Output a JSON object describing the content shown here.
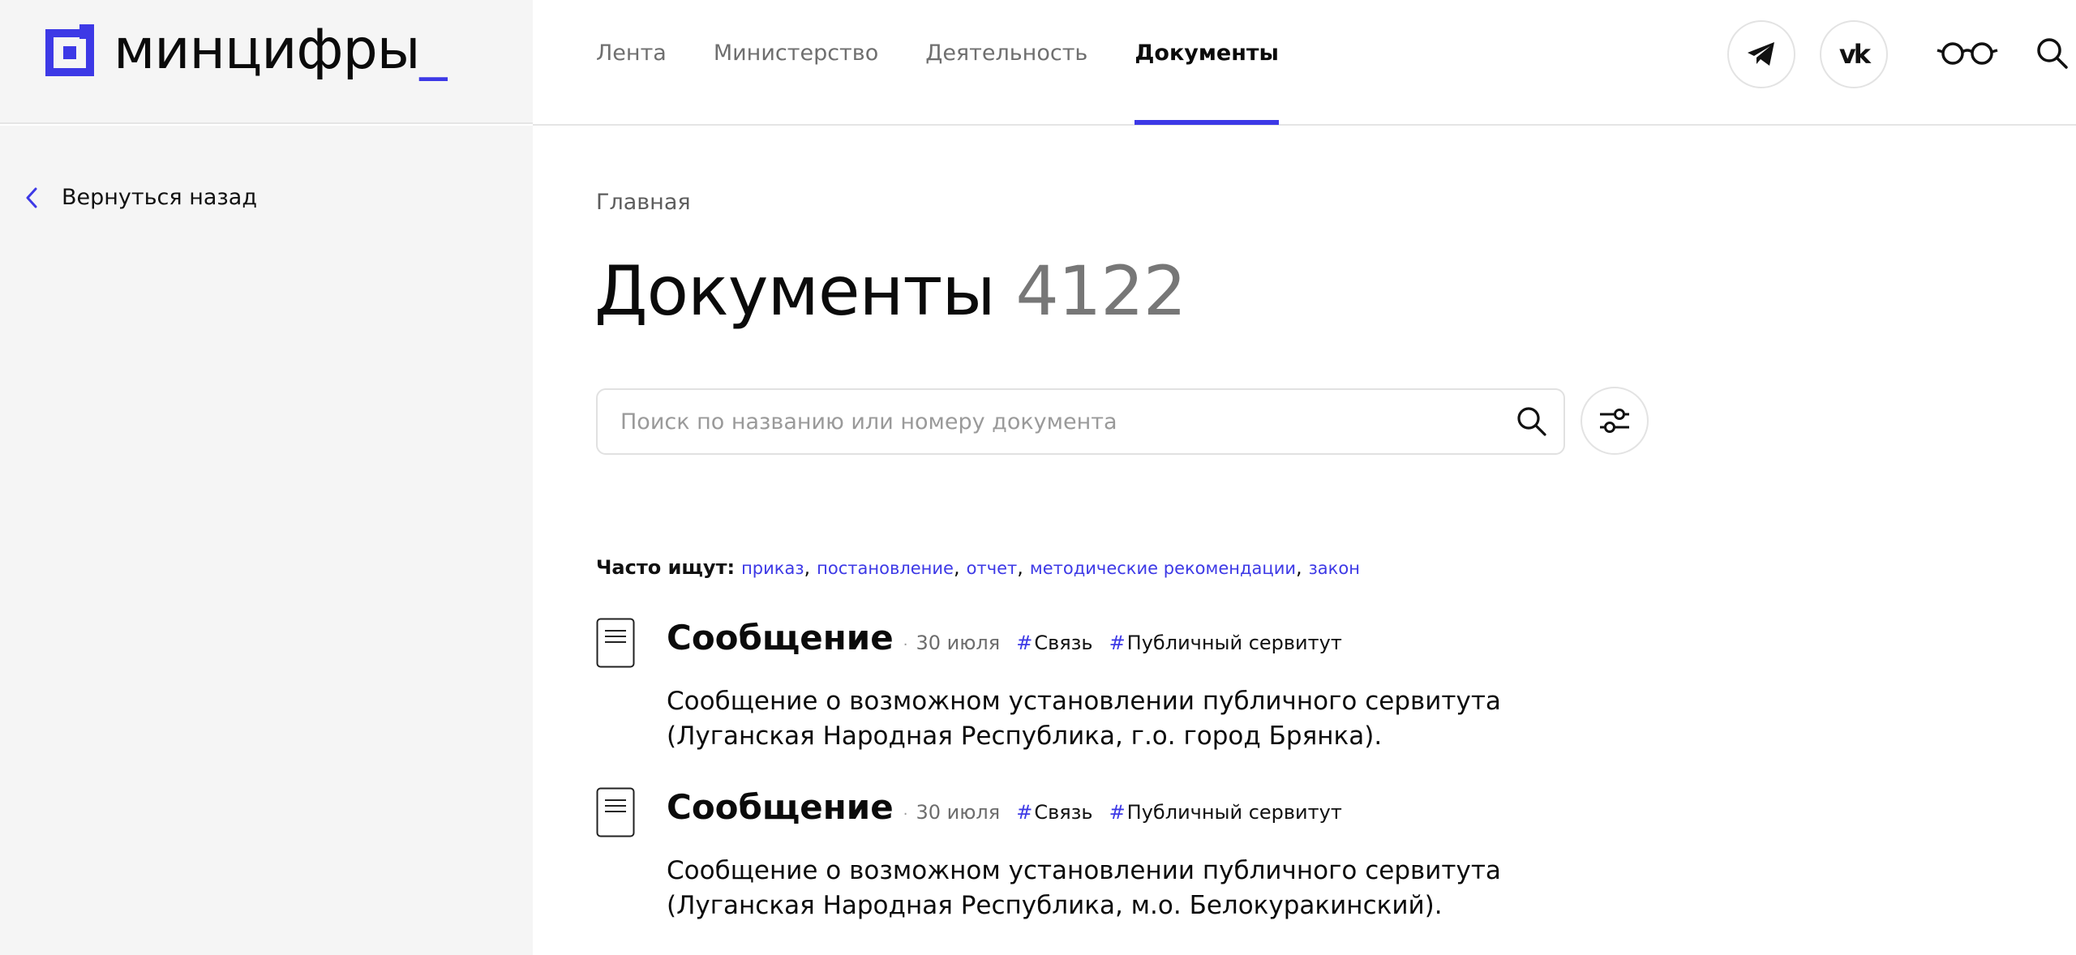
{
  "logo": {
    "text": "минцифры",
    "underscore": "_"
  },
  "sidebar": {
    "back_label": "Вернуться назад"
  },
  "nav": {
    "items": [
      {
        "label": "Лента"
      },
      {
        "label": "Министерство"
      },
      {
        "label": "Деятельность"
      },
      {
        "label": "Документы",
        "active": true
      }
    ]
  },
  "header_icons": [
    "telegram-icon",
    "vk-icon",
    "glasses-icon",
    "search-icon"
  ],
  "vk_glyph": "vk",
  "breadcrumb": "Главная",
  "page": {
    "title": "Документы",
    "count": "4122"
  },
  "search": {
    "placeholder": "Поиск по названию или номеру документа",
    "value": ""
  },
  "frequent": {
    "label": "Часто ищут:",
    "links": [
      "приказ",
      "постановление",
      "отчет",
      "методические рекомендации",
      "закон"
    ]
  },
  "documents": [
    {
      "type": "Сообщение",
      "date": "30 июля",
      "tags": [
        "Связь",
        "Публичный сервитут"
      ],
      "description": "Сообщение о возможном установлении публичного сервитута (Луганская Народная Республика, г.о. город Брянка)."
    },
    {
      "type": "Сообщение",
      "date": "30 июля",
      "tags": [
        "Связь",
        "Публичный сервитут"
      ],
      "description": "Сообщение о возможном установлении публичного сервитута (Луганская Народная Республика, м.о. Белокуракинский)."
    }
  ],
  "colors": {
    "accent": "#3d39e6",
    "sidebar_bg": "#f5f5f5",
    "muted": "#6f6f6f"
  }
}
